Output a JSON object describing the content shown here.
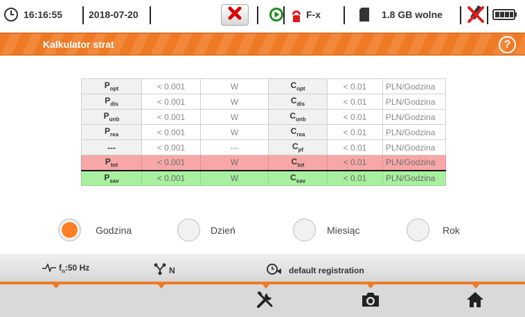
{
  "status": {
    "time": "16:16:55",
    "date": "2018-07-20",
    "clamp_type": "F-x",
    "memory_free": "1.8 GB wolne"
  },
  "title": "Kalkulator strat",
  "table": {
    "rows": [
      {
        "p_label": "P",
        "p_sub": "opt",
        "p_value": "< 0.001",
        "p_unit": "W",
        "c_label": "C",
        "c_sub": "opt",
        "c_value": "< 0.01",
        "c_unit": "PLN/Godzina"
      },
      {
        "p_label": "P",
        "p_sub": "dis",
        "p_value": "< 0.001",
        "p_unit": "W",
        "c_label": "C",
        "c_sub": "dis",
        "c_value": "< 0.01",
        "c_unit": "PLN/Godzina"
      },
      {
        "p_label": "P",
        "p_sub": "unb",
        "p_value": "< 0.001",
        "p_unit": "W",
        "c_label": "C",
        "c_sub": "unb",
        "c_value": "< 0.01",
        "c_unit": "PLN/Godzina"
      },
      {
        "p_label": "P",
        "p_sub": "rea",
        "p_value": "< 0.001",
        "p_unit": "W",
        "c_label": "C",
        "c_sub": "rea",
        "c_value": "< 0.01",
        "c_unit": "PLN/Godzina"
      },
      {
        "p_label": "---",
        "p_sub": "",
        "p_value": "< 0.001",
        "p_unit": "---",
        "c_label": "C",
        "c_sub": "pf",
        "c_value": "< 0.01",
        "c_unit": "PLN/Godzina"
      },
      {
        "p_label": "P",
        "p_sub": "tot",
        "p_value": "< 0.001",
        "p_unit": "W",
        "c_label": "C",
        "c_sub": "tot",
        "c_value": "< 0.01",
        "c_unit": "PLN/Godzina"
      },
      {
        "p_label": "P",
        "p_sub": "sav",
        "p_value": "< 0.001",
        "p_unit": "W",
        "c_label": "C",
        "c_sub": "sav",
        "c_value": "< 0.01",
        "c_unit": "PLN/Godzina"
      }
    ]
  },
  "period": {
    "options": [
      "Godzina",
      "Dzień",
      "Miesiąc",
      "Rok"
    ],
    "selected": "Godzina"
  },
  "info": {
    "frequency_label": "f",
    "frequency_sub": "n",
    "frequency_value": ":50 Hz",
    "network_label": "N",
    "registration": "default registration"
  },
  "colors": {
    "accent": "#ef7a25",
    "total_row": "#f7a7a7",
    "saving_row": "#a8f0a0"
  },
  "icons": [
    "clock-icon",
    "stop-icon",
    "play-icon",
    "clamp-icon",
    "sd-card-icon",
    "usb-icon",
    "battery-icon",
    "help-icon",
    "waveform-icon",
    "network-icon",
    "registration-icon",
    "tools-icon",
    "camera-icon",
    "home-icon"
  ]
}
